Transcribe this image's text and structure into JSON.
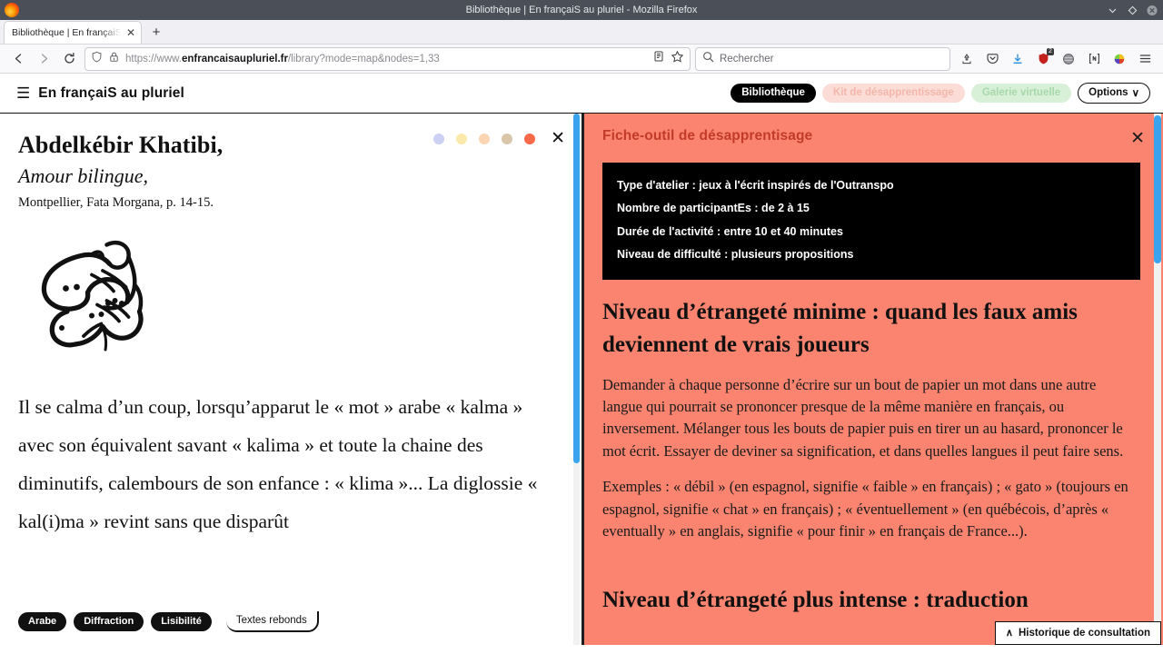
{
  "browser": {
    "window_title": "Bibliothèque | En françaiS au pluriel - Mozilla Firefox",
    "tab_label": "Bibliothèque | En françaiS au pluriel",
    "tab_close": "✕",
    "new_tab": "+",
    "url_prefix": "https://www.",
    "url_domain": "enfrancaisaupluriel.fr",
    "url_suffix": "/library?mode=map&nodes=1,33",
    "search_placeholder": "Rechercher",
    "extension_badge": "2",
    "window_controls": [
      "minimize",
      "restore",
      "close"
    ]
  },
  "site_header": {
    "menu_icon": "☰",
    "brand": "En françaiS au pluriel",
    "nav": [
      {
        "label": "Bibliothèque",
        "state": "active"
      },
      {
        "label": "Kit de désapprentissage",
        "state": "pink"
      },
      {
        "label": "Galerie virtuelle",
        "state": "green"
      }
    ],
    "options_label": "Options",
    "options_caret": "∨"
  },
  "left_panel": {
    "dot_colors": [
      "#ccd0f2",
      "#fbe8ab",
      "#fbd5b2",
      "#d8c5aa",
      "#fa6a4a"
    ],
    "close": "✕",
    "author": "Abdelkébir Khatibi,",
    "work": "Amour bilingue,",
    "reference": "Montpellier, Fata Morgana, p. 14-15.",
    "figure_alt": "arabic-calligraphy",
    "body": "Il se calma d’un coup, lorsqu’apparut le « mot » arabe « kalma » avec son équivalent savant « kalima » et toute la chaine des diminutifs, calembours de son enfance : « klima »... La diglossie « kal(i)ma » revint sans que disparût",
    "tags": [
      "Arabe",
      "Diffraction",
      "Lisibilité"
    ],
    "ghost_tag": "Textes rebonds"
  },
  "right_panel": {
    "background_color": "#fa8470",
    "title": "Fiche-outil de désapprentisage",
    "title_color": "#c23b2a",
    "close": "✕",
    "info_box": [
      "Type d'atelier : jeux à l'écrit inspirés de l'Outranspo",
      "Nombre de participantEs : de 2 à 15",
      "Durée de l'activité : entre 10 et 40 minutes",
      "Niveau de difficulté : plusieurs propositions"
    ],
    "section1_heading": "Niveau d’étrangeté minime : quand les faux amis deviennent de vrais joueurs",
    "section1_para1": "Demander à chaque personne d’écrire sur un bout de papier un mot dans une autre langue qui pourrait se prononcer presque de la même manière en français, ou inversement. Mélanger tous les bouts de papier puis en tirer un au hasard, prononcer le mot écrit. Essayer de deviner sa signification, et dans quelles langues il peut faire sens.",
    "section1_para2": "Exemples : « débil » (en espagnol, signifie « faible » en français) ; « gato » (toujours en espagnol, signifie « chat » en français) ; « éventuellement » (en québécois, d’après « eventually » en anglais, signifie « pour finir » en français de France...).",
    "section2_heading": "Niveau d’étrangeté plus intense : traduction"
  },
  "history_button": {
    "caret": "∧",
    "label": "Historique de consultation"
  }
}
